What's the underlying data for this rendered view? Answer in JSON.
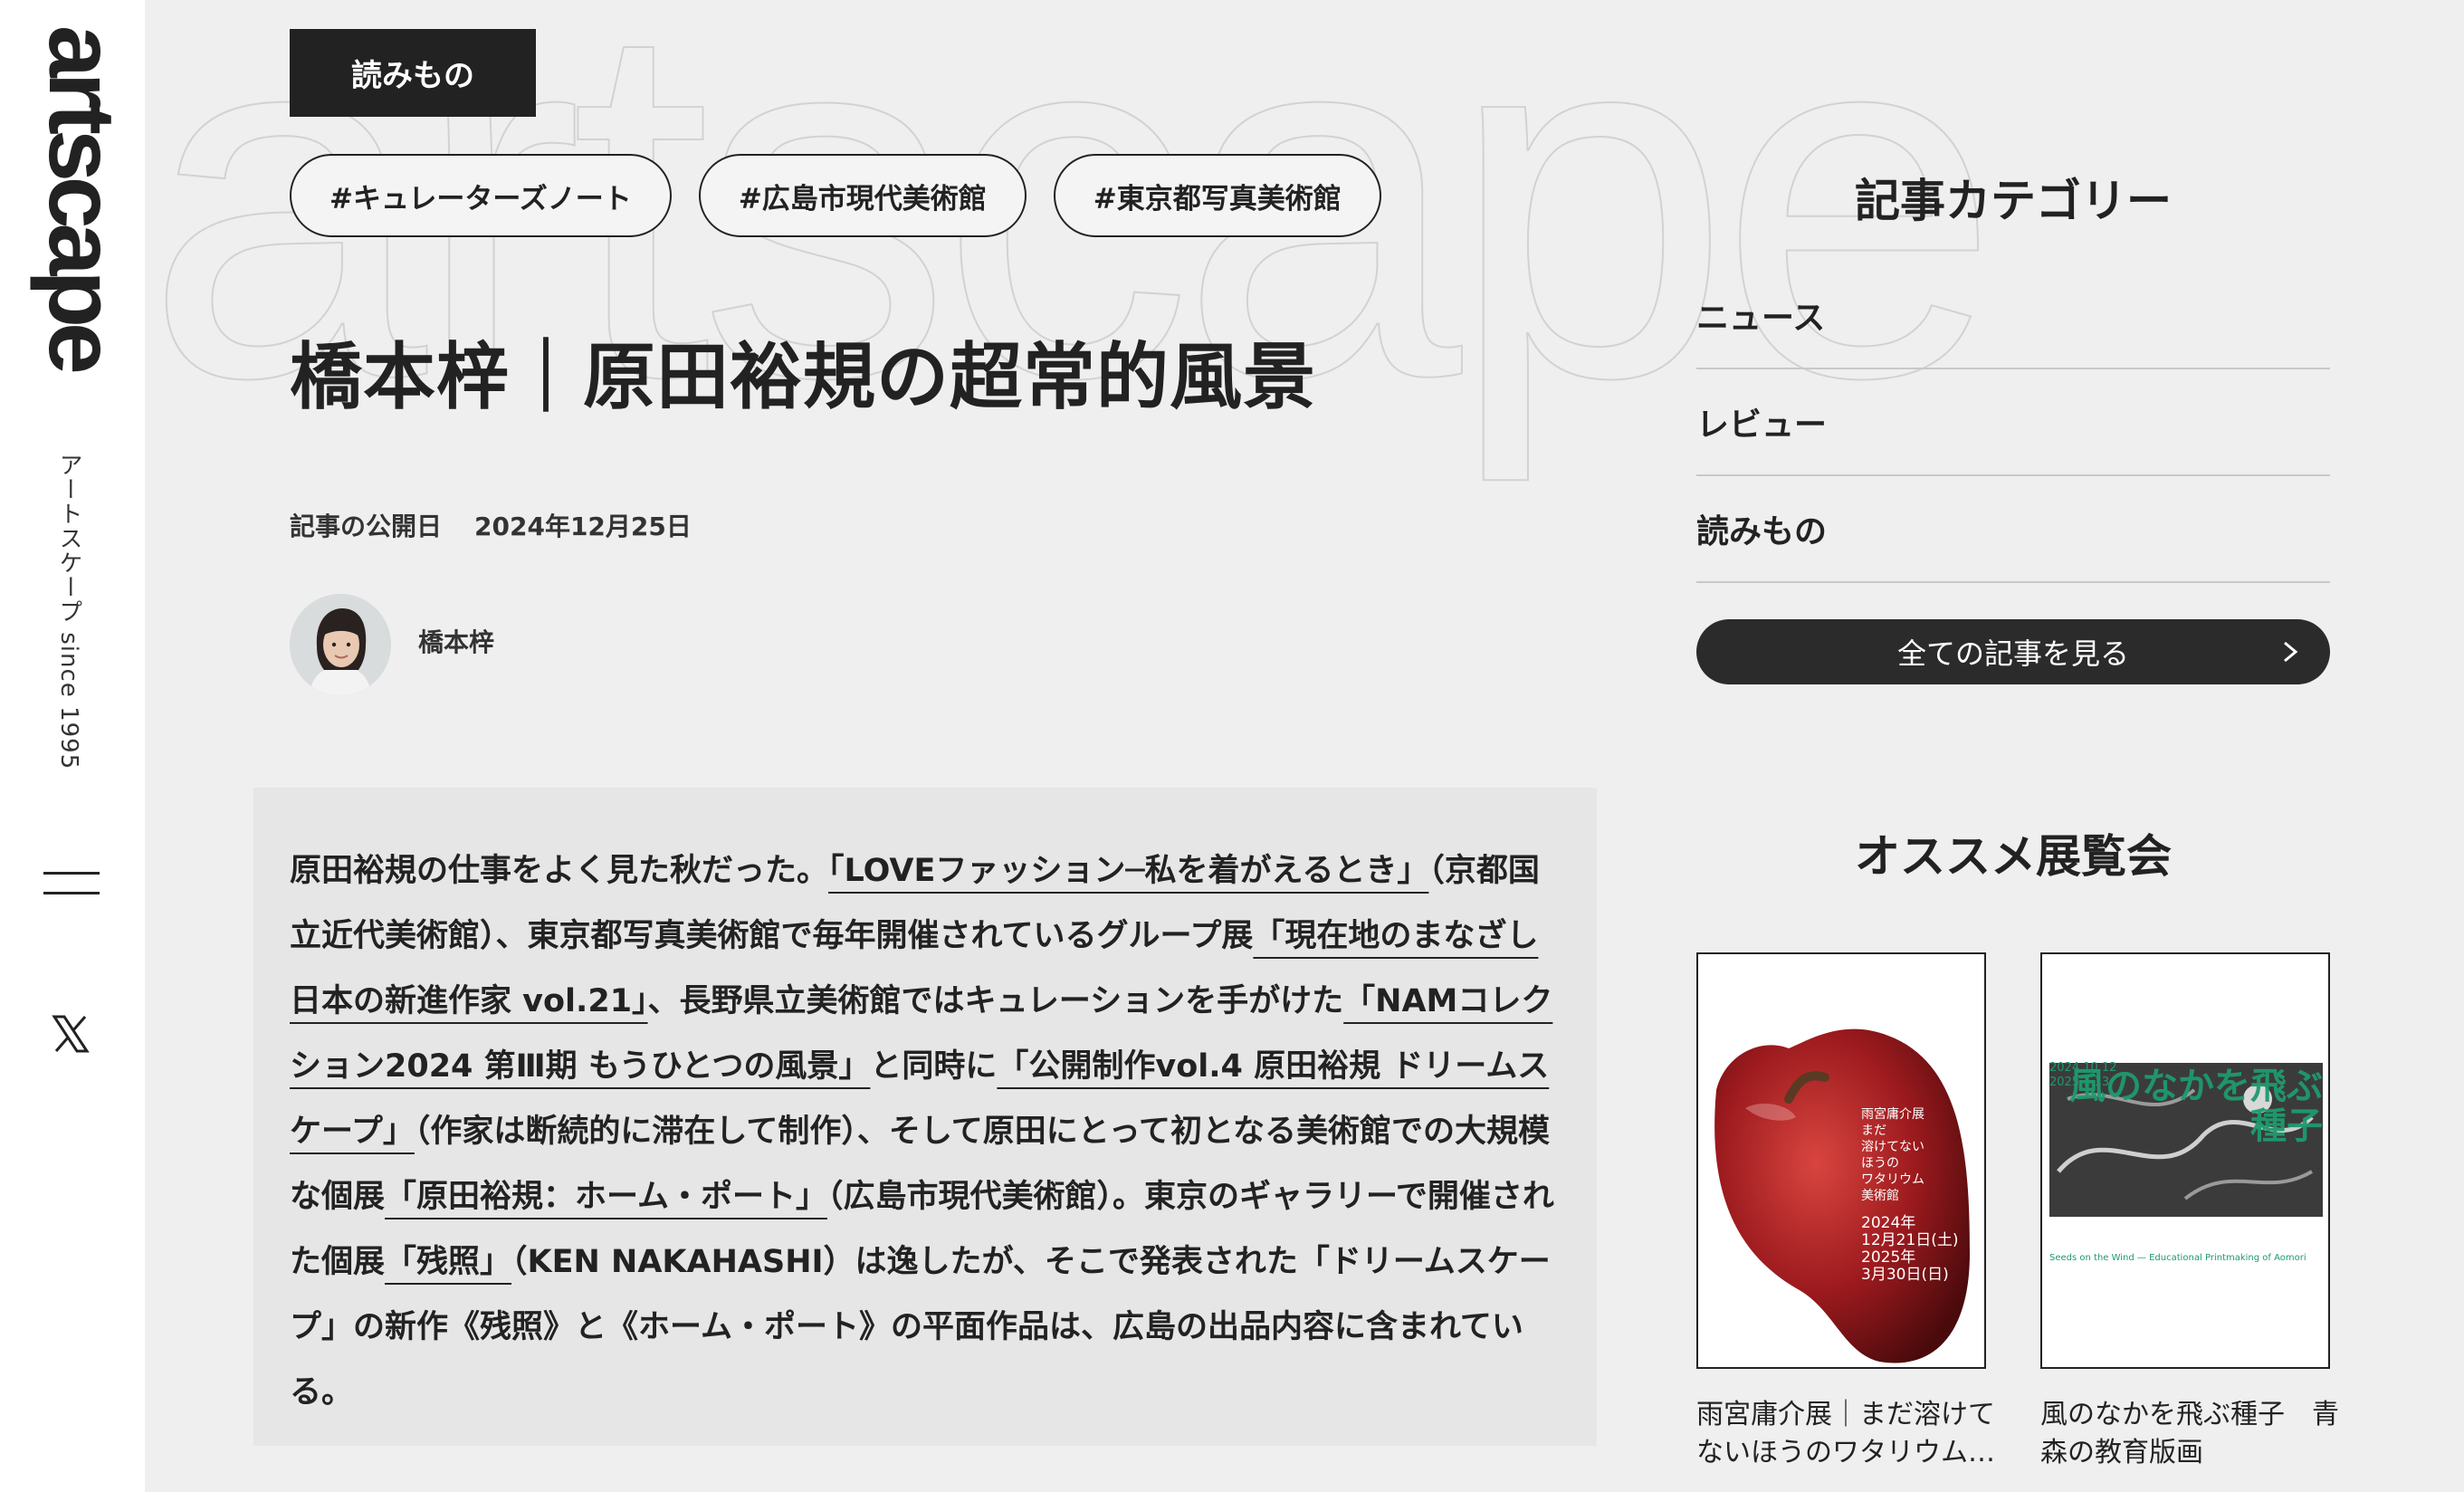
{
  "sidebar": {
    "logo": "artscape",
    "tagline": "アートスケープ since 1995"
  },
  "background_word": "artscape",
  "article": {
    "category": "読みもの",
    "tags": [
      "#キュレーターズノート",
      "#広島市現代美術館",
      "#東京都写真美術館"
    ],
    "title": "橋本梓｜原田裕規の超常的風景",
    "date_label": "記事の公開日",
    "date": "2024年12月25日",
    "author": "橋本梓",
    "body": {
      "t1": "原田裕規の仕事をよく見た秋だった。",
      "l1": "「LOVEファッション─私を着がえるとき」",
      "t2": "（京都国立近代美術館）、東京都写真美術館で毎年開催されているグループ展",
      "l2": "「現在地のまなざし 日本の新進作家 vol.21」",
      "t3": "、長野県立美術館ではキュレーションを手がけた",
      "l3": "「NAMコレクション2024 第Ⅲ期 もうひとつの風景」",
      "t4": "と同時に",
      "l4": "「公開制作vol.4 原田裕規 ドリームスケープ」",
      "t5": "（作家は断続的に滞在して制作）、そして原田にとって初となる美術館での大規模な個展",
      "l5": "「原田裕規：ホーム・ポート」",
      "t6": "（広島市現代美術館）。東京のギャラリーで開催された個展",
      "l6": "「残照」",
      "t7": "（KEN NAKAHASHI）は逸したが、そこで発表された「ドリームスケープ」の新作《残照》と《ホーム・ポート》の平面作品は、広島の出品内容に含まれている。"
    }
  },
  "categories": {
    "heading": "記事カテゴリー",
    "items": [
      "ニュース",
      "レビュー",
      "読みもの"
    ],
    "all_button": "全ての記事を見る"
  },
  "recommended": {
    "heading": "オススメ展覧会",
    "cards": [
      {
        "caption": "雨宮庸介展｜まだ溶けてないほうのワタリウム…",
        "poster_lines": [
          "雨宮庸介展",
          "まだ",
          "溶けてない",
          "ほうの",
          "ワタリウム",
          "美術館"
        ],
        "poster_dates": [
          "2024年",
          "12月21日(土)",
          "2025年",
          "3月30日(日)"
        ]
      },
      {
        "caption": "風のなかを飛ぶ種子　青森の教育版画",
        "poster_title": "風のなかを飛ぶ種子",
        "poster_dates": [
          "2024.10.12",
          "2025.1.13"
        ],
        "poster_subtitle": "Seeds on the Wind — Educational Printmaking of Aomori"
      }
    ]
  },
  "colors": {
    "background": "#efefef",
    "sidebar": "#ffffff",
    "dark": "#222222",
    "poster_green": "#1e9a6e",
    "apple_red": "#9c1a1e"
  }
}
